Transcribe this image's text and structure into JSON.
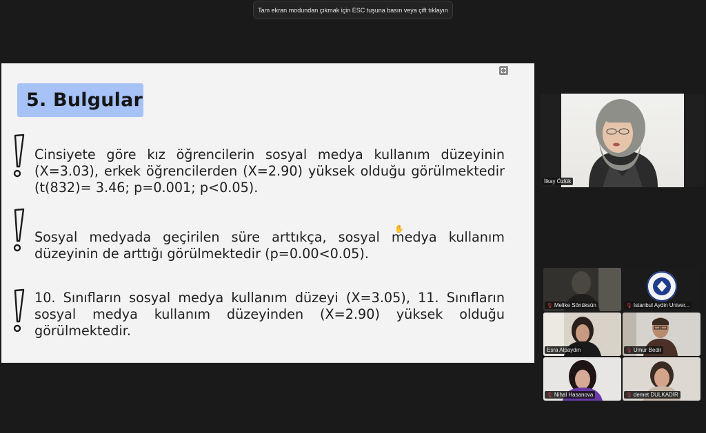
{
  "toast": {
    "text": "Tam ekran modundan çıkmak için ESC tuşuna basın veya çift tıklayın"
  },
  "slide": {
    "title": "5. Bulgular",
    "paragraphs": [
      "Cinsiyete göre kız öğrencilerin sosyal medya kullanım düzeyinin (X=3.03), erkek öğrencilerden (X=2.90) yüksek olduğu görülmektedir (t(832)= 3.46; p=0.001; p<0.05).",
      "Sosyal medyada geçirilen süre arttıkça, sosyal medya kullanım düzeyinin de arttığı görülmektedir (p=0.00<0.05).",
      "10. Sınıfların sosyal medya kullanım düzeyi (X=3.05), 11. Sınıfların sosyal medya kullanım düzeyinden (X=2.90) yüksek olduğu görülmektedir."
    ]
  },
  "speaker": {
    "name": "İlkay Özlük"
  },
  "participants": [
    {
      "name": "Melike Sönüksün"
    },
    {
      "name": "Istanbul Aydin Univer..."
    },
    {
      "name": "Esra Alpaydın"
    },
    {
      "name": "Umur Bedir"
    },
    {
      "name": "Nihal Hasanova"
    },
    {
      "name": "demet DULKADİR"
    }
  ]
}
